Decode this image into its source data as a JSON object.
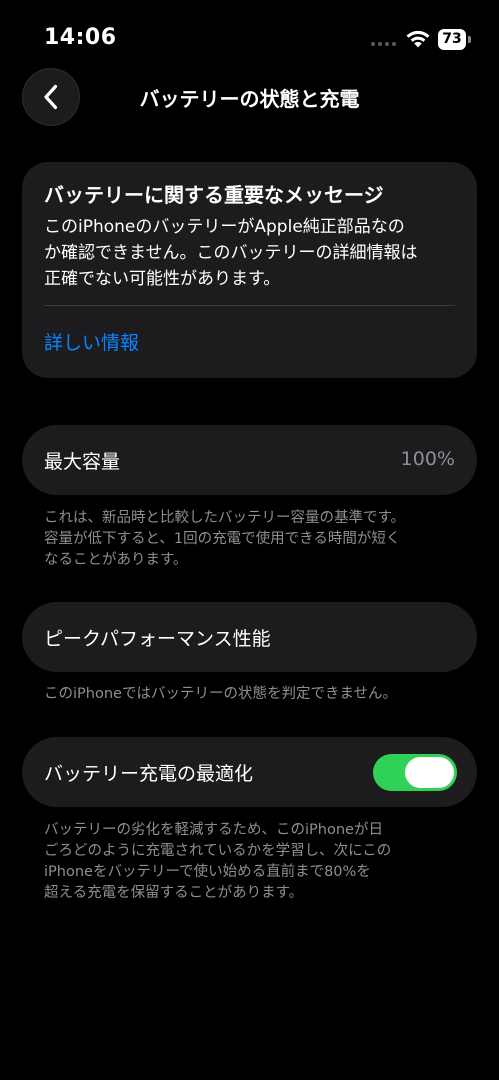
{
  "status_bar": {
    "time": "14:06",
    "battery_level": "73"
  },
  "nav": {
    "title": "バッテリーの状態と充電"
  },
  "message_card": {
    "title": "バッテリーに関する重要なメッセージ",
    "body_lines": [
      "このiPhoneのバッテリーがApple純正部品なの",
      "か確認できません。このバッテリーの詳細情報は",
      "正確でない可能性があります。"
    ],
    "link_label": "詳しい情報"
  },
  "max_capacity": {
    "label": "最大容量",
    "value": "100%",
    "footnote_lines": [
      "これは、新品時と比較したバッテリー容量の基準です。",
      "容量が低下すると、1回の充電で使用できる時間が短く",
      "なることがあります。"
    ]
  },
  "peak_performance": {
    "label": "ピークパフォーマンス性能",
    "footnote": "このiPhoneではバッテリーの状態を判定できません。"
  },
  "optimized_charging": {
    "label": "バッテリー充電の最適化",
    "enabled": true,
    "toggle_color": "#30d158",
    "footnote_lines": [
      "バッテリーの劣化を軽減するため、このiPhoneが日",
      "ごろどのように充電されているかを学習し、次にこの",
      "iPhoneをバッテリーで使い始める直前まで80%を",
      "超える充電を保留することがあります。"
    ]
  }
}
